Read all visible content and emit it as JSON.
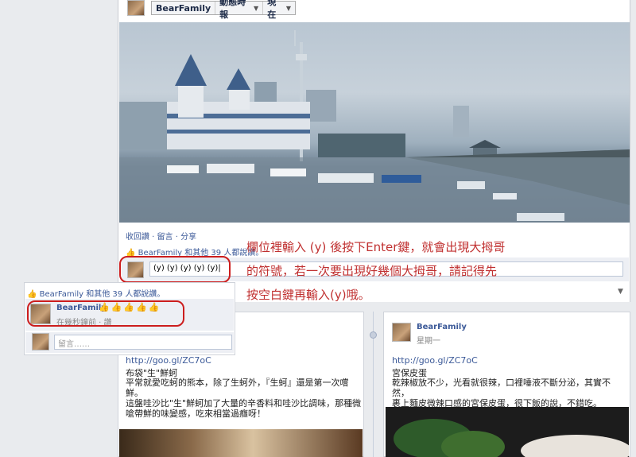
{
  "header": {
    "name": "BearFamily",
    "filter1": "動態時報",
    "filter2": "現在"
  },
  "post": {
    "actions": "收回讚 · 留言 · 分享",
    "likes": "BearFamily 和其他 39 人都說讚。",
    "comment_input": "(y) (y) (y) (y) (y)|"
  },
  "annotation": {
    "line1": "欄位裡輸入 (y) 後按下Enter鍵，就會出現大拇哥",
    "line2": "的符號，若一次要出現好幾個大拇哥，請記得先",
    "line3": "按空白鍵再輸入(y)哦。"
  },
  "inset": {
    "likes": "BearFamily 和其他 39 人都說讚。",
    "name": "BearFamily",
    "thumbs": "👍👍👍👍👍",
    "time": "在幾秒鐘前 · 讚",
    "placeholder": "留言……"
  },
  "card_left": {
    "link": "http://goo.gl/ZC7oC",
    "title": "布袋\"生\"鮮蚵",
    "body1": "平常就愛吃蚵的熊本，除了生蚵外，『生蚵』還是第一次嚐",
    "body2": "鮮。",
    "body3": "這盤哇沙比\"生\"鮮蚵加了大量的辛香料和哇沙比調味，那種微",
    "body4": "嗆帶鮮的味變感，吃來相當過癮呀！"
  },
  "card_right": {
    "name": "BearFamily",
    "time": "星期一",
    "link": "http://goo.gl/ZC7oC",
    "title": "宮保皮蛋",
    "body1": "乾辣椒放不少，光看就很辣，口裡唾液不斷分泌，其實不然，",
    "body2": "裹上麵皮微辣口感的宮保皮蛋，很下飯的說，不錯吃。"
  },
  "colors": {
    "fb_blue": "#3b5998",
    "annot_red": "#c03030",
    "highlight_red": "#cc1d1d"
  }
}
